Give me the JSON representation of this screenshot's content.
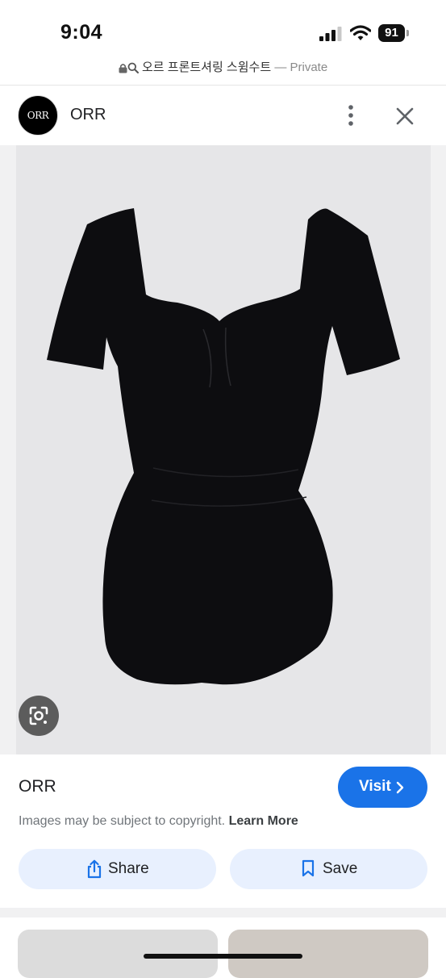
{
  "status_bar": {
    "time": "9:04",
    "battery": "91"
  },
  "url_bar": {
    "title": "오르 프론트셔링 스윔수트",
    "separator": "—",
    "mode": "Private"
  },
  "header": {
    "logo_text": "ORR",
    "site_name": "ORR"
  },
  "image": {
    "subject": "black short-sleeve swimsuit",
    "background_color": "#e6e6e8",
    "garment_color": "#0d0d10"
  },
  "info": {
    "site_name": "ORR",
    "visit_label": "Visit",
    "copyright_text": "Images may be subject to copyright.",
    "learn_more": "Learn More",
    "share_label": "Share",
    "save_label": "Save"
  },
  "colors": {
    "accent": "#1a73e8",
    "action_bg": "#e8f0fe"
  }
}
